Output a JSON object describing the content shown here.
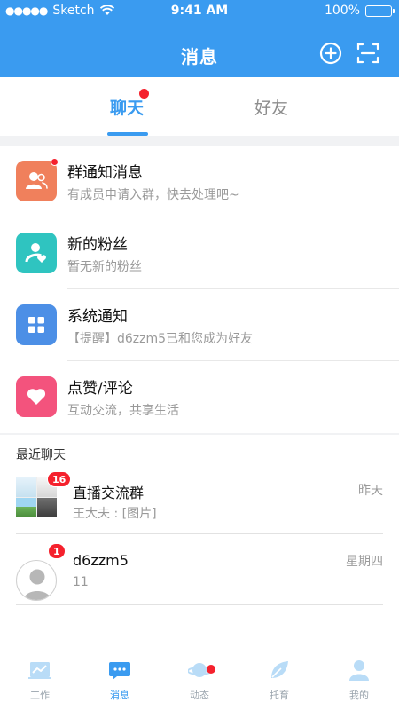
{
  "status_bar": {
    "carrier": "Sketch",
    "time": "9:41 AM",
    "battery": "100%"
  },
  "header": {
    "title": "消息",
    "add_icon": "plus-circle-icon",
    "scan_icon": "scan-icon"
  },
  "tabs": [
    {
      "label": "聊天",
      "active": true,
      "has_dot": true
    },
    {
      "label": "好友",
      "active": false
    }
  ],
  "notices": [
    {
      "title": "群通知消息",
      "subtitle": "有成员申请入群，快去处理吧~",
      "icon": "group-icon",
      "color": "#f0805c",
      "has_dot": true
    },
    {
      "title": "新的粉丝",
      "subtitle": "暂无新的粉丝",
      "icon": "fan-icon",
      "color": "#2fc4c0"
    },
    {
      "title": "系统通知",
      "subtitle": "【提醒】d6zzm5已和您成为好友",
      "icon": "grid-icon",
      "color": "#4c8fe6"
    },
    {
      "title": "点赞/评论",
      "subtitle": "互动交流，共享生活",
      "icon": "heart-icon",
      "color": "#f3537d"
    }
  ],
  "recent_label": "最近聊天",
  "chats": [
    {
      "name": "直播交流群",
      "message": "王大夫 : [图片]",
      "time": "昨天",
      "badge": "16",
      "avatar": "group-avatar"
    },
    {
      "name": "d6zzm5",
      "message": "11",
      "time": "星期四",
      "badge": "1",
      "avatar": "user-avatar"
    }
  ],
  "nav": [
    {
      "label": "工作",
      "icon": "chart-icon",
      "active": false
    },
    {
      "label": "消息",
      "icon": "message-icon",
      "active": true
    },
    {
      "label": "动态",
      "icon": "planet-icon",
      "active": false,
      "has_dot": true
    },
    {
      "label": "托育",
      "icon": "leaf-icon",
      "active": false
    },
    {
      "label": "我的",
      "icon": "person-icon",
      "active": false
    }
  ],
  "colors": {
    "primary": "#3a9bf0",
    "badge": "#f5212d",
    "divider": "#e8e8e8"
  }
}
